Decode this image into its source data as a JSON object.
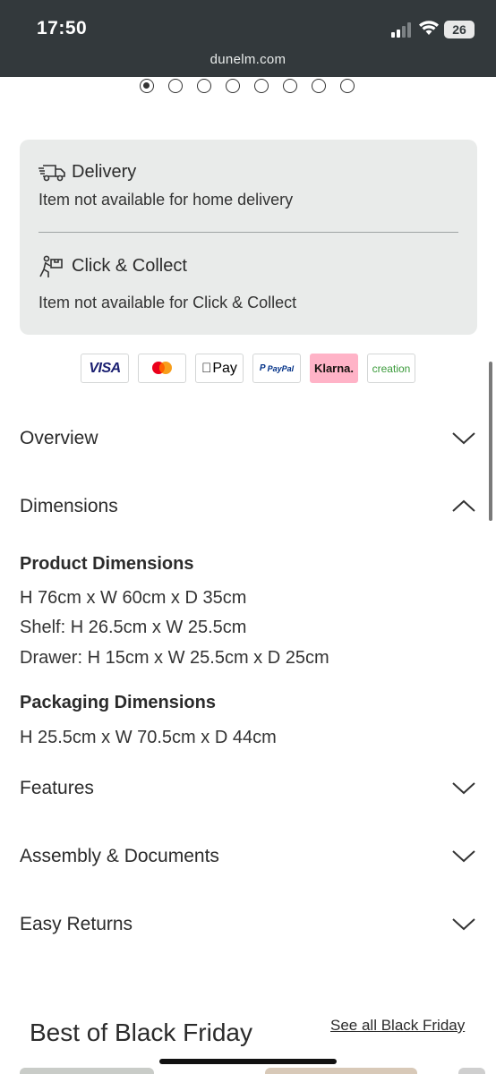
{
  "status_bar": {
    "time": "17:50",
    "url": "dunelm.com",
    "battery": "26"
  },
  "carousel": {
    "count": 8,
    "active_index": 0
  },
  "availability": {
    "delivery": {
      "title": "Delivery",
      "subtitle": "Item not available for home delivery"
    },
    "collect": {
      "title": "Click & Collect",
      "subtitle": "Item not available for Click & Collect"
    }
  },
  "payments": {
    "visa": "VISA",
    "mastercard": "mastercard-logo",
    "apple_pay": "Pay",
    "paypal": "PayPal",
    "klarna": "Klarna.",
    "creation": "creation"
  },
  "accordion": {
    "overview": "Overview",
    "dimensions": "Dimensions",
    "features": "Features",
    "assembly": "Assembly & Documents",
    "returns": "Easy Returns"
  },
  "dimensions": {
    "product_title": "Product Dimensions",
    "product_lines": [
      "H 76cm x W 60cm x D 35cm",
      "Shelf: H 26.5cm x W 25.5cm",
      "Drawer: H 15cm x W 25.5cm x D 25cm"
    ],
    "packaging_title": "Packaging Dimensions",
    "packaging_line": "H 25.5cm x W 70.5cm x D 44cm"
  },
  "black_friday": {
    "title": "Best of Black Friday",
    "link": "See all Black Friday"
  },
  "colors": {
    "status_bar": "#33393c",
    "panel": "#e9ebea",
    "klarna": "#ffb3c7"
  }
}
